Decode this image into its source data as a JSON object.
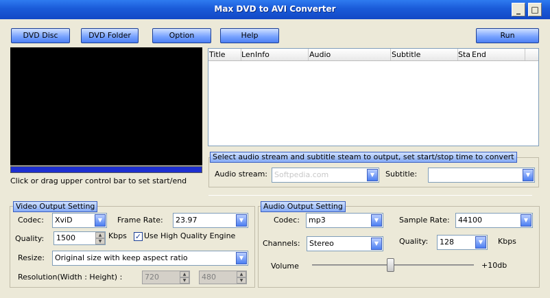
{
  "window": {
    "title": "Max DVD to AVI Converter",
    "minimize_glyph": "_",
    "maximize_glyph": "□",
    "close_glyph": "✕"
  },
  "toolbar": {
    "dvd_disc": "DVD Disc",
    "dvd_folder": "DVD Folder",
    "option": "Option",
    "help": "Help",
    "run": "Run"
  },
  "preview": {
    "hint": "Click or drag upper control bar to set start/end"
  },
  "title_list": {
    "columns": [
      "Title",
      "Length",
      "Info",
      "Audio",
      "Subtitle",
      "Start",
      "End"
    ]
  },
  "stream_select": {
    "legend": "Select audio stream and subtitle steam to output, set start/stop time to convert",
    "audio_label": "Audio stream:",
    "audio_value": "",
    "audio_watermark": "Softpedia.com",
    "subtitle_label": "Subtitle:",
    "subtitle_value": ""
  },
  "video": {
    "legend": "Video Output Setting",
    "codec_label": "Codec:",
    "codec_value": "XviD",
    "framerate_label": "Frame Rate:",
    "framerate_value": "23.97",
    "quality_label": "Quality:",
    "quality_value": "1500",
    "quality_unit": "Kbps",
    "hq_label": "Use High Quality Engine",
    "hq_checked": true,
    "resize_label": "Resize:",
    "resize_value": "Original size with keep aspect ratio",
    "resolution_label": "Resolution(Width : Height) :",
    "width_value": "720",
    "height_value": "480"
  },
  "audio": {
    "legend": "Audio Output Setting",
    "codec_label": "Codec:",
    "codec_value": "mp3",
    "samplerate_label": "Sample Rate:",
    "samplerate_value": "44100",
    "channels_label": "Channels:",
    "channels_value": "Stereo",
    "quality_label": "Quality:",
    "quality_value": "128",
    "quality_unit": "Kbps",
    "volume_label": "Volume",
    "volume_value": "+10db"
  },
  "icons": {
    "dropdown": "chevron-down-icon",
    "spin_up": "spin-up-icon",
    "spin_down": "spin-down-icon",
    "check": "checkmark-icon"
  }
}
